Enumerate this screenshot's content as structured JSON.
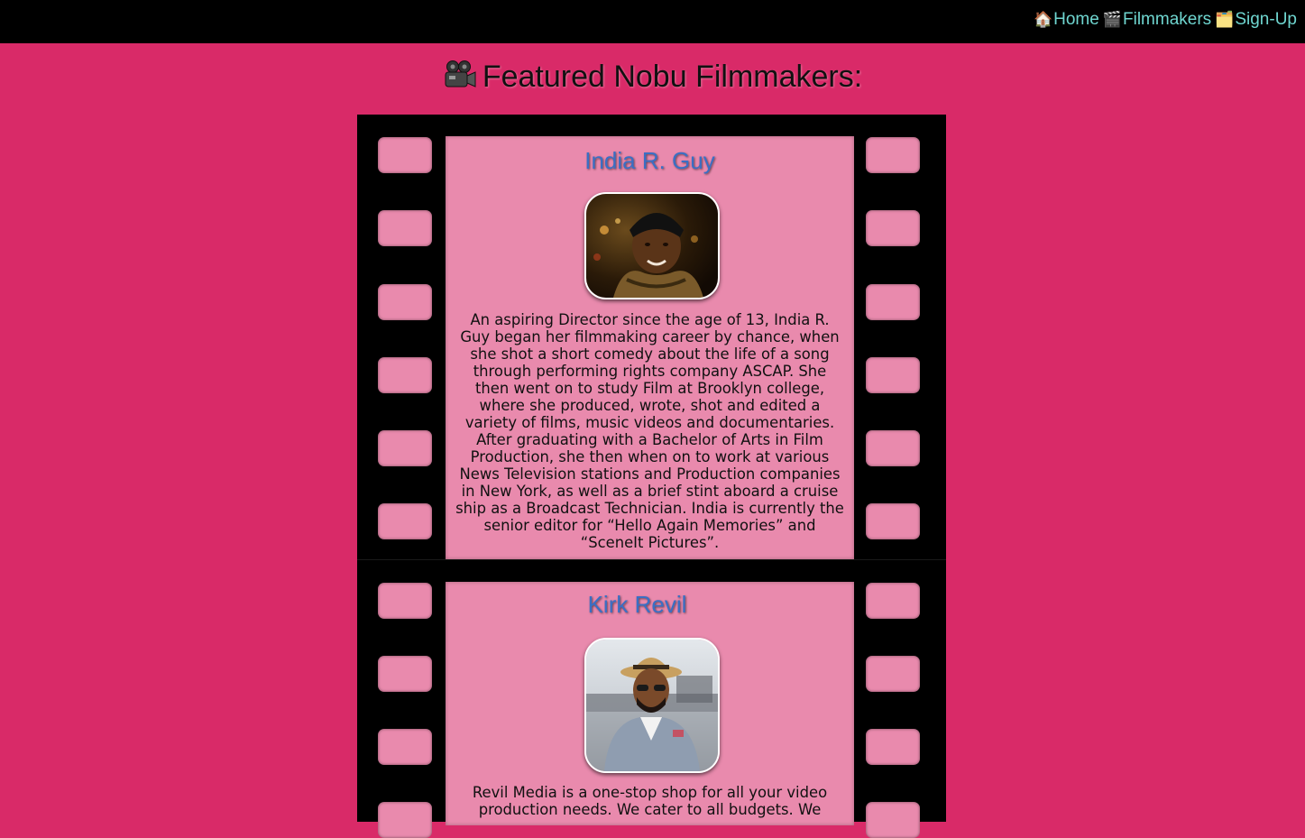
{
  "nav": {
    "home": {
      "icon": "house-icon",
      "glyph": "🏠",
      "label": "Home"
    },
    "filmmakers": {
      "icon": "clapperboard-icon",
      "glyph": "🎬",
      "label": "Filmmakers"
    },
    "signup": {
      "icon": "card-index-icon",
      "glyph": "🗂️",
      "label": "Sign-Up"
    }
  },
  "page": {
    "title": "Featured Nobu Filmmakers:",
    "title_icon": "video-camera-icon"
  },
  "filmmakers": [
    {
      "name": "India R. Guy",
      "photo_alt": "portrait-photo",
      "bio": "An aspiring Director since the age of 13, India R. Guy began her filmmaking career by chance, when she shot a short comedy about the life of a song through performing rights company ASCAP. She then went on to study Film at Brooklyn college, where she produced, wrote, shot and edited a variety of films, music videos and documentaries. After graduating with a Bachelor of Arts in Film Production, she then when on to work at various News Television stations and Production companies in New York, as well as a brief stint aboard a cruise ship as a Broadcast Technician. India is currently the senior editor for “Hello Again Memories” and “SceneIt Pictures”."
    },
    {
      "name": "Kirk Revil",
      "photo_alt": "portrait-photo",
      "bio": "Revil Media is a one-stop shop for all your video production needs. We cater to all budgets. We"
    }
  ],
  "colors": {
    "background": "#d92a68",
    "frame": "#e98aad",
    "nav_link": "#6fd6d0",
    "name": "#3a6fc4"
  }
}
